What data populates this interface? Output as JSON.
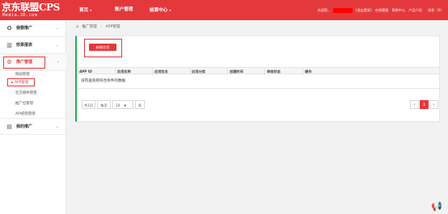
{
  "brand": {
    "logo_text": "京东联盟CPS",
    "logo_sub": "Media.JD.com"
  },
  "top_nav": [
    {
      "label": "首页",
      "has_caret": true
    },
    {
      "label": "账户管理",
      "has_caret": false
    },
    {
      "label": "结算中心",
      "has_caret": true
    }
  ],
  "top_right": {
    "welcome": "欢迎您，",
    "logout": "[退出登录]",
    "links": [
      "在线客服",
      "帮助中心",
      "产品介绍",
      "消息"
    ],
    "message_badge": "(0)"
  },
  "sidebar": {
    "groups": [
      {
        "label": "我要推广",
        "icon": "megaphone-icon",
        "glyph": "✪",
        "chevron": "⌄"
      },
      {
        "label": "效果报表",
        "icon": "chart-icon",
        "glyph": "▥",
        "chevron": "⌄"
      },
      {
        "label": "推广管理",
        "icon": "gear-icon",
        "glyph": "⚙",
        "chevron": "›"
      },
      {
        "label": "我的推广",
        "icon": "document-icon",
        "glyph": "▤",
        "chevron": "⌄"
      }
    ],
    "sub_items": [
      "网站管理",
      "APP管理",
      "社交媒体管理",
      "推广位管理",
      "API权限管理"
    ]
  },
  "breadcrumb": {
    "home_icon": "⌂",
    "items": [
      "推广管理",
      "APP管理"
    ],
    "separator": "›"
  },
  "actions": {
    "create_app": "新建应用"
  },
  "table": {
    "columns": [
      "APP ID",
      "应用名称",
      "应用包名",
      "应用分类",
      "创建时间",
      "审核状态",
      "操作"
    ],
    "empty_text": "没有查询到符合条件的数据"
  },
  "pagination": {
    "total_label": "共1页",
    "per_page_label": "每页",
    "per_page_value": "10",
    "per_page_unit": "条",
    "prev": "‹",
    "current": "1",
    "next": "›"
  },
  "colors": {
    "brand_red": "#e4393c",
    "accent_green": "#23b14d",
    "annotation_red": "#e4393c"
  }
}
